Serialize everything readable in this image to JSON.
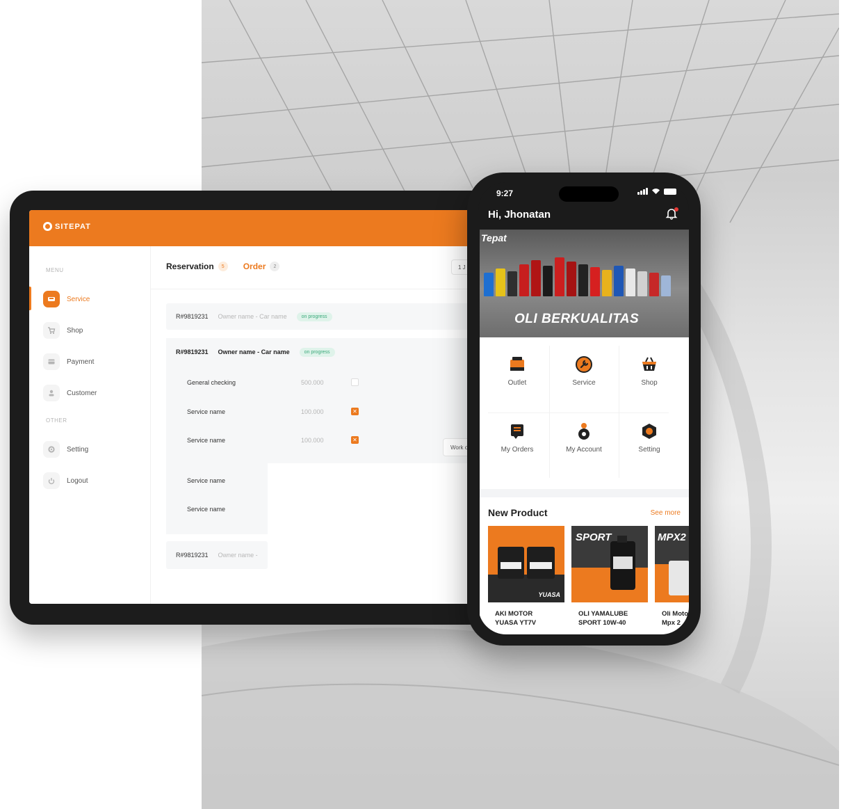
{
  "tablet": {
    "brand": "SITEPAT",
    "sidebar": {
      "menu_label": "MENU",
      "other_label": "OTHER",
      "items": [
        {
          "label": "Service",
          "icon": "car-icon",
          "active": true
        },
        {
          "label": "Shop",
          "icon": "cart-icon"
        },
        {
          "label": "Payment",
          "icon": "wallet-icon"
        },
        {
          "label": "Customer",
          "icon": "user-icon"
        }
      ],
      "other_items": [
        {
          "label": "Setting",
          "icon": "gear-icon"
        },
        {
          "label": "Logout",
          "icon": "power-icon"
        }
      ]
    },
    "tabs": [
      {
        "label": "Reservation",
        "count": "5"
      },
      {
        "label": "Order",
        "count": "2"
      }
    ],
    "date_filter": "1 J",
    "rows": [
      {
        "id": "R#9819231",
        "owner": "Owner name - Car name",
        "status": "on progress"
      },
      {
        "id": "R#9819231",
        "owner": "Owner name - Car name",
        "status": "on progress"
      },
      {
        "id": "R#9819231",
        "owner": "Owner name -"
      }
    ],
    "services": [
      {
        "name": "General checking",
        "amount": "500.000",
        "checked": false
      },
      {
        "name": "Service name",
        "amount": "100.000",
        "checked": true
      },
      {
        "name": "Service name",
        "amount": "100.000",
        "checked": true
      },
      {
        "name": "Service name"
      },
      {
        "name": "Service name"
      }
    ],
    "work_button": "Work o"
  },
  "phone": {
    "time": "9:27",
    "greeting": "Hi, Jhonatan",
    "banner": {
      "brand": "Tepat",
      "title": "OLI BERKUALITAS"
    },
    "menu": [
      {
        "label": "Outlet",
        "icon": "store-icon"
      },
      {
        "label": "Service",
        "icon": "wrench-icon"
      },
      {
        "label": "Shop",
        "icon": "basket-icon"
      },
      {
        "label": "My Orders",
        "icon": "receipt-icon"
      },
      {
        "label": "My Account",
        "icon": "account-icon"
      },
      {
        "label": "Setting",
        "icon": "hex-gear-icon"
      }
    ],
    "new_product": {
      "title": "New Product",
      "see_more": "See more",
      "products": [
        {
          "name": "AKI MOTOR\nYUASA YT7V",
          "image_text": "YUASA"
        },
        {
          "name": "OLI YAMALUBE\nSPORT 10W-40",
          "image_text": "SPORT"
        },
        {
          "name": "Oli Moto\nMpx 2",
          "image_text": "MPX2"
        }
      ]
    }
  },
  "colors": {
    "accent": "#ec7a1f",
    "success": "#3aa87a",
    "dark": "#1b1b1b"
  }
}
